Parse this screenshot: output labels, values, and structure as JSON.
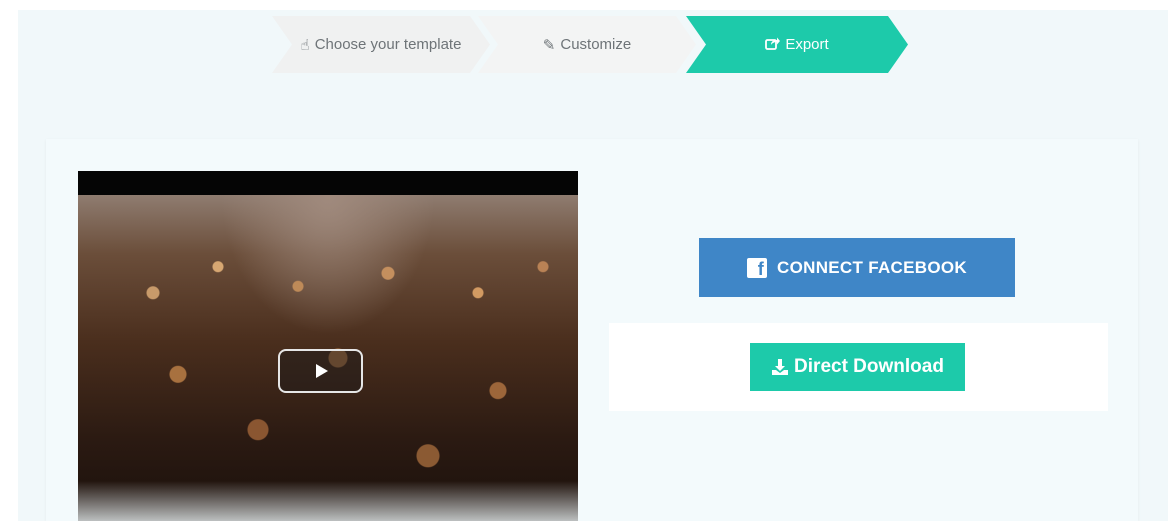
{
  "stepper": {
    "steps": [
      {
        "label": "Choose your template",
        "icon": "hand-pointer-icon",
        "active": false
      },
      {
        "label": "Customize",
        "icon": "edit-icon",
        "active": false
      },
      {
        "label": "Export",
        "icon": "share-square-icon",
        "active": true
      }
    ]
  },
  "video": {
    "play_icon": "play-icon"
  },
  "actions": {
    "facebook_label": "CONNECT FACEBOOK",
    "download_label": "Direct Download"
  },
  "colors": {
    "accent": "#1dcaaa",
    "facebook": "#3f86c7",
    "background": "#f1f8fa"
  }
}
